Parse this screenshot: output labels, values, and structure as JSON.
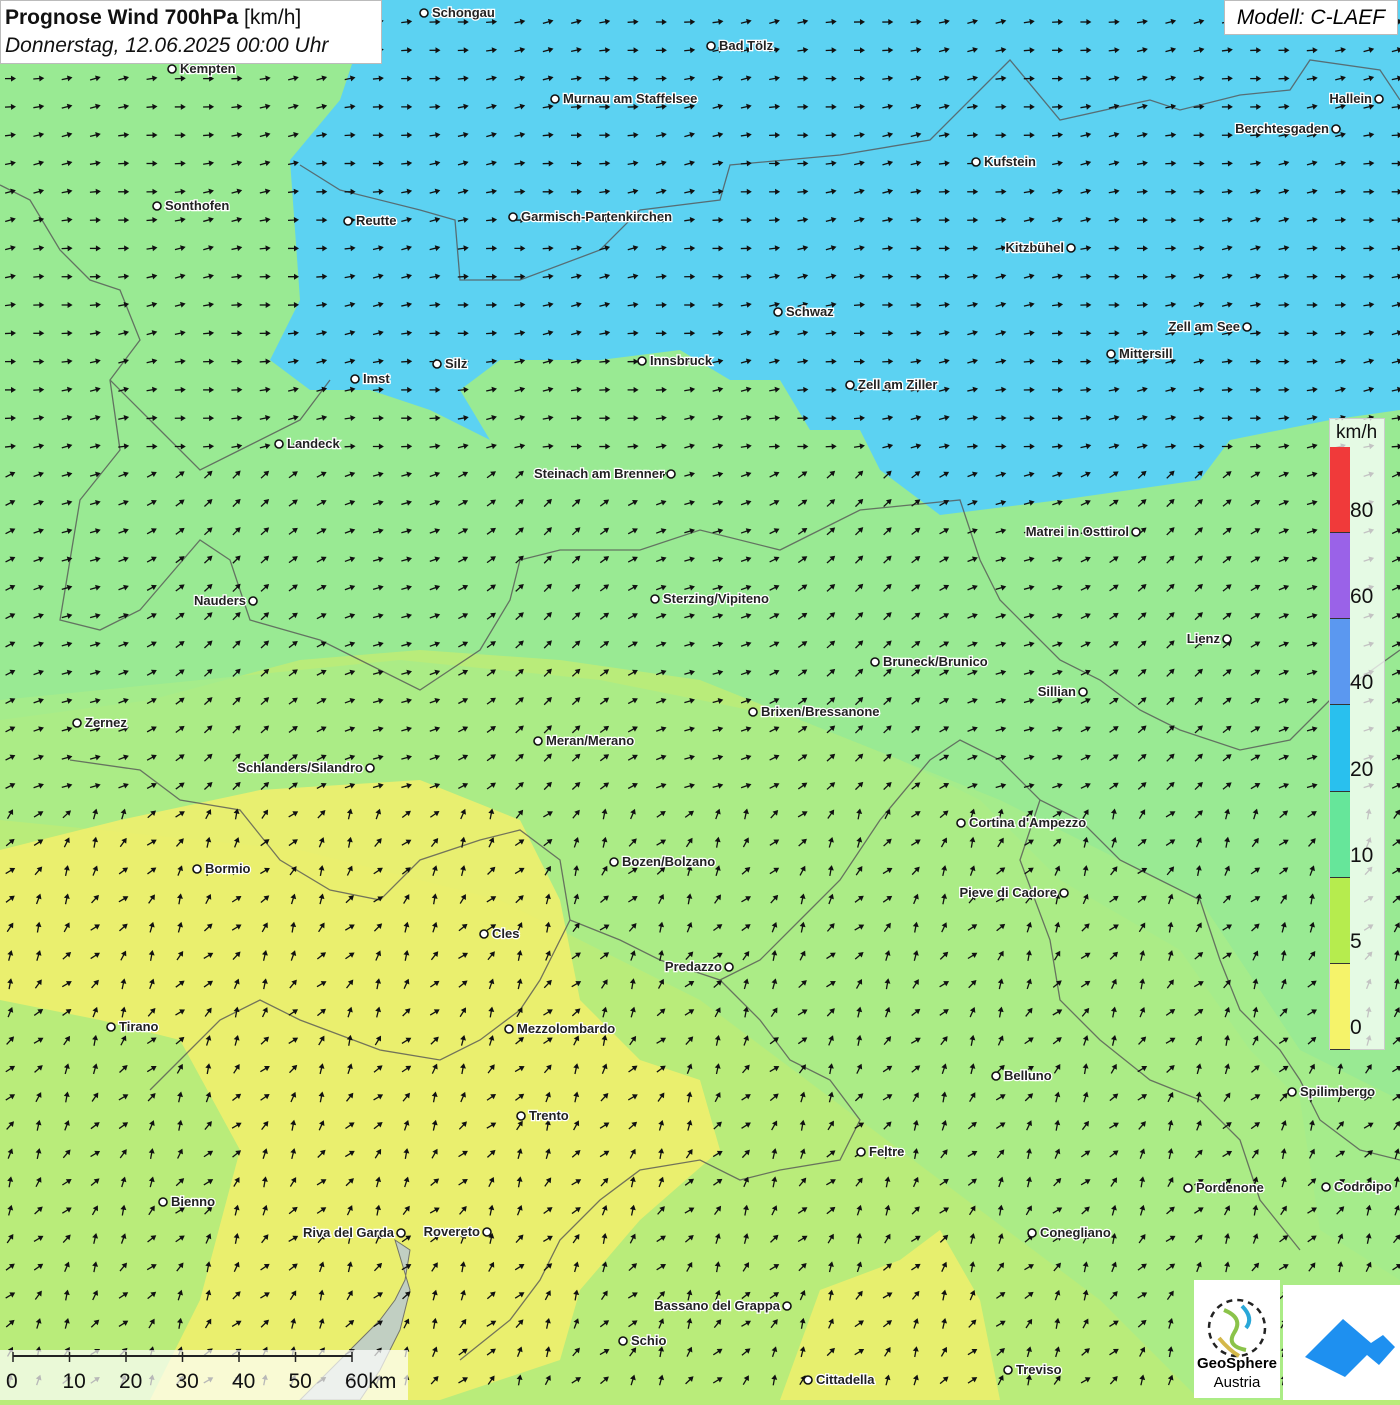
{
  "title": {
    "main": "Prognose Wind 700hPa",
    "unit": "[km/h]",
    "date": "Donnerstag, 12.06.2025 00:00 Uhr"
  },
  "model": "Modell: C-LAEF",
  "legend": {
    "unit": "km/h",
    "ticks": [
      "80",
      "60",
      "40",
      "20",
      "10",
      "5",
      "0"
    ],
    "colors": [
      "#f03a3a",
      "#9a62e8",
      "#5b98f0",
      "#29c0ee",
      "#66e69a",
      "#b6ec4e",
      "#f5f36a"
    ]
  },
  "scalebar": {
    "ticks": [
      "0",
      "10",
      "20",
      "30",
      "40",
      "50",
      "60km"
    ]
  },
  "logos": {
    "geosphere_line1": "GeoSphere",
    "geosphere_line2": "Austria"
  },
  "colors": {
    "wind_0_5": "#f2f06c",
    "wind_5_10": "#b9ec7a",
    "wind_10_20": "#8eea98",
    "wind_20_40": "#5cd2f2"
  },
  "cities": [
    {
      "name": "Schongau"
    },
    {
      "name": "Bad Tölz"
    },
    {
      "name": "Kempten"
    },
    {
      "name": "Murnau am Staffelsee"
    },
    {
      "name": "Hallein"
    },
    {
      "name": "Berchtesgaden"
    },
    {
      "name": "Kufstein"
    },
    {
      "name": "Sonthofen"
    },
    {
      "name": "Reutte"
    },
    {
      "name": "Garmisch-Partenkirchen"
    },
    {
      "name": "Kitzbühel"
    },
    {
      "name": "Schwaz"
    },
    {
      "name": "Zell am See"
    },
    {
      "name": "Mittersill"
    },
    {
      "name": "Imst"
    },
    {
      "name": "Silz"
    },
    {
      "name": "Innsbruck"
    },
    {
      "name": "Zell am Ziller"
    },
    {
      "name": "Landeck"
    },
    {
      "name": "Steinach am Brenner"
    },
    {
      "name": "Matrei in Osttirol"
    },
    {
      "name": "Nauders"
    },
    {
      "name": "Sterzing/Vipiteno"
    },
    {
      "name": "Lienz"
    },
    {
      "name": "Bruneck/Brunico"
    },
    {
      "name": "Sillian"
    },
    {
      "name": "Zernez"
    },
    {
      "name": "Brixen/Bressanone"
    },
    {
      "name": "Meran/Merano"
    },
    {
      "name": "Schlanders/Silandro"
    },
    {
      "name": "Cortina d'Ampezzo"
    },
    {
      "name": "Bormio"
    },
    {
      "name": "Bozen/Bolzano"
    },
    {
      "name": "Pieve di Cadore"
    },
    {
      "name": "Cles"
    },
    {
      "name": "Predazzo"
    },
    {
      "name": "Tirano"
    },
    {
      "name": "Mezzolombardo"
    },
    {
      "name": "Belluno"
    },
    {
      "name": "Spilimbergo"
    },
    {
      "name": "Trento"
    },
    {
      "name": "Feltre"
    },
    {
      "name": "Pordenone"
    },
    {
      "name": "Codroipo"
    },
    {
      "name": "Bienno"
    },
    {
      "name": "Riva del Garda"
    },
    {
      "name": "Rovereto"
    },
    {
      "name": "Conegliano"
    },
    {
      "name": "Bassano del Grappa"
    },
    {
      "name": "Schio"
    },
    {
      "name": "Treviso"
    },
    {
      "name": "Cittadella"
    }
  ]
}
